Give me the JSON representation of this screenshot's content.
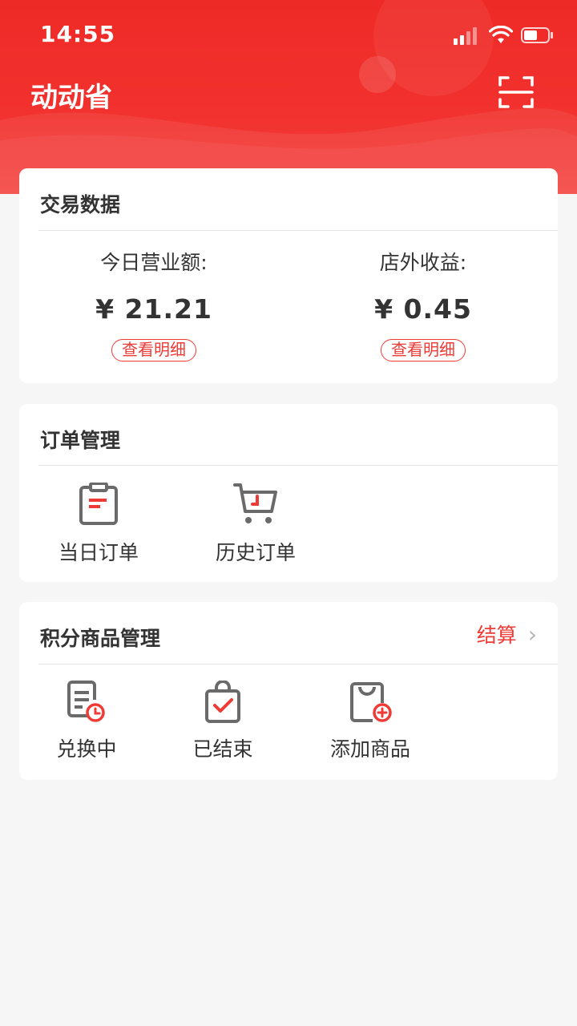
{
  "status_bar": {
    "time": "14:55"
  },
  "header": {
    "title": "动动省",
    "scan_icon": "scan-icon"
  },
  "colors": {
    "brand_red": "#f03a36",
    "icon_gray": "#6a6a6a",
    "background": "#f6f6f6"
  },
  "trade_card": {
    "title": "交易数据",
    "today": {
      "label": "今日营业额:",
      "value": "¥ 21.21",
      "detail_label": "查看明细"
    },
    "external": {
      "label": "店外收益:",
      "value": "¥ 0.45",
      "detail_label": "查看明细"
    }
  },
  "order_card": {
    "title": "订单管理",
    "items": [
      {
        "label": "当日订单",
        "icon": "clipboard-list-icon"
      },
      {
        "label": "历史订单",
        "icon": "shopping-cart-clock-icon"
      }
    ]
  },
  "points_card": {
    "title": "积分商品管理",
    "action_label": "结算",
    "items": [
      {
        "label": "兑换中",
        "icon": "document-clock-icon"
      },
      {
        "label": "已结束",
        "icon": "bag-check-icon"
      },
      {
        "label": "添加商品",
        "icon": "bag-add-icon"
      }
    ]
  }
}
